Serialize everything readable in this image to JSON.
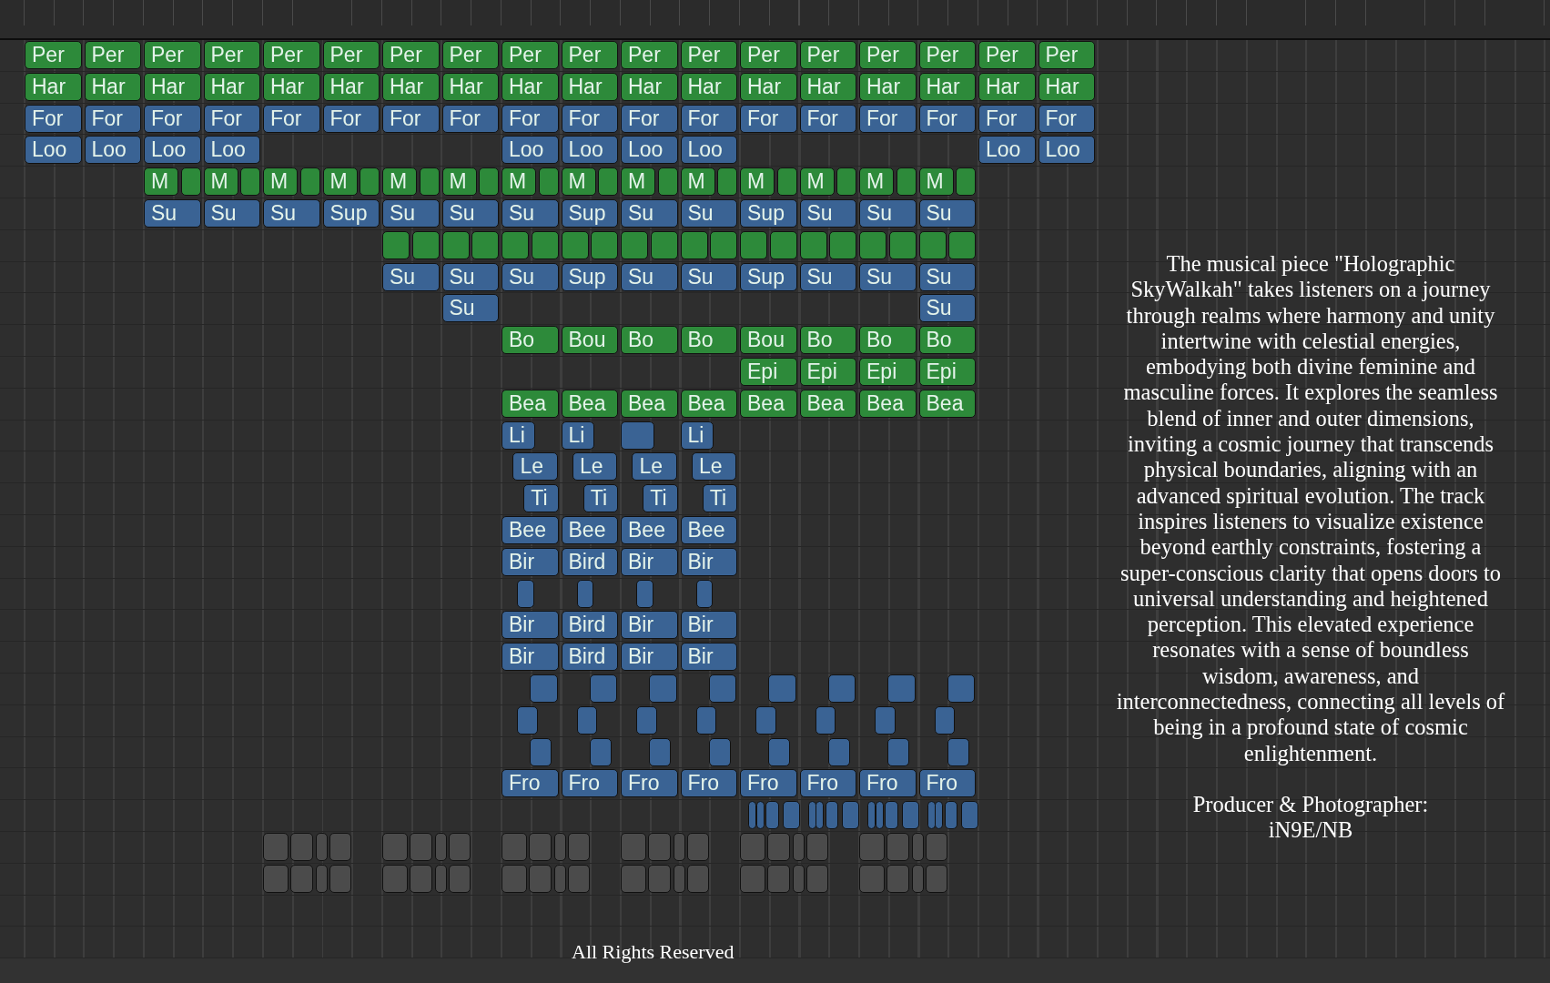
{
  "tracks": [
    {
      "color": "#2d8a3a",
      "clips": [
        "Per",
        "Per",
        "Per",
        "Per",
        "Per",
        "Per",
        "Per",
        "Per",
        "Per",
        "Per",
        "Per",
        "Per",
        "Per",
        "Per",
        "Per",
        "Per",
        "Per",
        "Per"
      ]
    },
    {
      "color": "#2d8a3a",
      "clips": [
        "Har",
        "Har",
        "Har",
        "Har",
        "Har",
        "Har",
        "Har",
        "Har",
        "Har",
        "Har",
        "Har",
        "Har",
        "Har",
        "Har",
        "Har",
        "Har",
        "Har",
        "Har"
      ]
    },
    {
      "color": "#3a6394",
      "clips": [
        "For",
        "For",
        "For",
        "For",
        "For",
        "For",
        "For",
        "For",
        "For",
        "For",
        "For",
        "For",
        "For",
        "For",
        "For",
        "For",
        "For",
        "For"
      ]
    },
    {
      "color": "#3a6394",
      "clips": [
        "Loo",
        "Loo",
        "Loo",
        "Loo",
        "Loo",
        "Loo",
        "Loo",
        "Loo",
        "Loo",
        "Loo"
      ]
    },
    {
      "color": "#2d8a3a",
      "clips": [
        "M",
        "M",
        "M",
        "M",
        "M",
        "M",
        "M",
        "M",
        "M",
        "M",
        "M",
        "M",
        "M",
        "M"
      ]
    },
    {
      "color": "#3a6394",
      "clips": [
        "Su",
        "Su",
        "Su",
        "Sup",
        "Su",
        "Su",
        "Su",
        "Sup",
        "Su",
        "Su",
        "Sup",
        "Su",
        "Su",
        "Su"
      ]
    },
    {
      "color": "#2d8a3a"
    },
    {
      "color": "#3a6394",
      "clips": [
        "Su",
        "Su",
        "Su",
        "Sup",
        "Su",
        "Su",
        "Sup",
        "Su",
        "Su",
        "Su"
      ]
    },
    {
      "color": "#3a6394",
      "clips": [
        "Su",
        "Su"
      ]
    },
    {
      "color": "#2d8a3a",
      "clips": [
        "Bo",
        "Bou",
        "Bo",
        "Bo",
        "Bou",
        "Bo",
        "Bo",
        "Bo"
      ]
    },
    {
      "color": "#2d8a3a",
      "clips": [
        "Epi",
        "Epi",
        "Epi",
        "Epi"
      ]
    },
    {
      "color": "#2d8a3a",
      "clips": [
        "Bea",
        "Bea",
        "Bea",
        "Bea",
        "Bea",
        "Bea",
        "Bea",
        "Bea"
      ]
    },
    {
      "color": "#3a6394",
      "clips": [
        "Li",
        "Li",
        "Li"
      ]
    },
    {
      "color": "#3a6394",
      "clips": [
        "Le",
        "Le",
        "Le",
        "Le"
      ]
    },
    {
      "color": "#3a6394",
      "clips": [
        "Ti",
        "Ti",
        "Ti",
        "Ti"
      ]
    },
    {
      "color": "#3a6394",
      "clips": [
        "Bee",
        "Bee",
        "Bee",
        "Bee"
      ]
    },
    {
      "color": "#3a6394",
      "clips": [
        "Bir",
        "Bird",
        "Bir",
        "Bir"
      ]
    },
    {
      "color": "#3a6394"
    },
    {
      "color": "#3a6394",
      "clips": [
        "Bir",
        "Bird",
        "Bir",
        "Bir"
      ]
    },
    {
      "color": "#3a6394",
      "clips": [
        "Bir",
        "Bird",
        "Bir",
        "Bir"
      ]
    },
    {
      "color": "#3a6394"
    },
    {
      "color": "#3a6394"
    },
    {
      "color": "#3a6394"
    },
    {
      "color": "#3a6394",
      "clips": [
        "Fro",
        "Fro",
        "Fro",
        "Fro",
        "Fro",
        "Fro",
        "Fro",
        "Fro"
      ]
    },
    {
      "color": "#3a6394"
    },
    {
      "color": "#4b4b4b"
    },
    {
      "color": "#4b4b4b"
    }
  ],
  "description": "The musical piece \"Holographic SkyWalkah\" takes listeners on a journey through realms where harmony and unity intertwine with celestial energies, embodying both divine feminine and masculine forces. It explores the seamless blend of inner and outer dimensions, inviting a cosmic journey that transcends physical boundaries, aligning with an advanced spiritual evolution. The track inspires listeners to visualize existence beyond earthly constraints, fostering a super-conscious clarity that opens doors to universal understanding and heightened perception. This elevated experience resonates with a sense of boundless wisdom, awareness, and interconnectedness, connecting all levels of being in a profound state of cosmic enlightenment.",
  "credit_label": "Producer & Photographer:",
  "credit_name": "iN9E/NB",
  "footer": "All Rights Reserved"
}
